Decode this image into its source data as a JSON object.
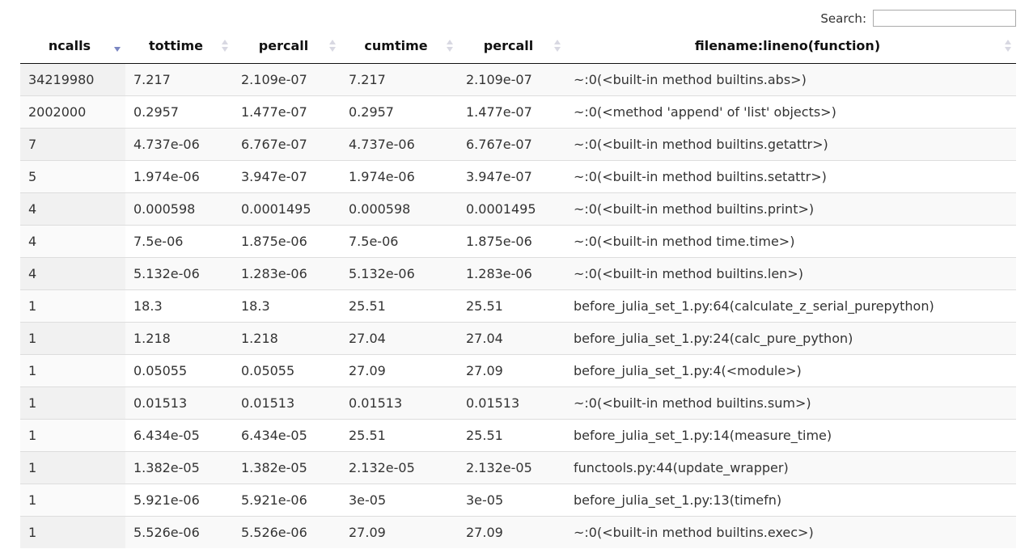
{
  "search": {
    "label": "Search:",
    "value": "",
    "placeholder": ""
  },
  "columns": [
    {
      "label": "ncalls",
      "sort": "descending"
    },
    {
      "label": "tottime",
      "sort": "none"
    },
    {
      "label": "percall",
      "sort": "none"
    },
    {
      "label": "cumtime",
      "sort": "none"
    },
    {
      "label": "percall",
      "sort": "none"
    },
    {
      "label": "filename:lineno(function)",
      "sort": "none"
    }
  ],
  "rows": [
    [
      "34219980",
      "7.217",
      "2.109e-07",
      "7.217",
      "2.109e-07",
      "~:0(<built-in method builtins.abs>)"
    ],
    [
      "2002000",
      "0.2957",
      "1.477e-07",
      "0.2957",
      "1.477e-07",
      "~:0(<method 'append' of 'list' objects>)"
    ],
    [
      "7",
      "4.737e-06",
      "6.767e-07",
      "4.737e-06",
      "6.767e-07",
      "~:0(<built-in method builtins.getattr>)"
    ],
    [
      "5",
      "1.974e-06",
      "3.947e-07",
      "1.974e-06",
      "3.947e-07",
      "~:0(<built-in method builtins.setattr>)"
    ],
    [
      "4",
      "0.000598",
      "0.0001495",
      "0.000598",
      "0.0001495",
      "~:0(<built-in method builtins.print>)"
    ],
    [
      "4",
      "7.5e-06",
      "1.875e-06",
      "7.5e-06",
      "1.875e-06",
      "~:0(<built-in method time.time>)"
    ],
    [
      "4",
      "5.132e-06",
      "1.283e-06",
      "5.132e-06",
      "1.283e-06",
      "~:0(<built-in method builtins.len>)"
    ],
    [
      "1",
      "18.3",
      "18.3",
      "25.51",
      "25.51",
      "before_julia_set_1.py:64(calculate_z_serial_purepython)"
    ],
    [
      "1",
      "1.218",
      "1.218",
      "27.04",
      "27.04",
      "before_julia_set_1.py:24(calc_pure_python)"
    ],
    [
      "1",
      "0.05055",
      "0.05055",
      "27.09",
      "27.09",
      "before_julia_set_1.py:4(<module>)"
    ],
    [
      "1",
      "0.01513",
      "0.01513",
      "0.01513",
      "0.01513",
      "~:0(<built-in method builtins.sum>)"
    ],
    [
      "1",
      "6.434e-05",
      "6.434e-05",
      "25.51",
      "25.51",
      "before_julia_set_1.py:14(measure_time)"
    ],
    [
      "1",
      "1.382e-05",
      "1.382e-05",
      "2.132e-05",
      "2.132e-05",
      "functools.py:44(update_wrapper)"
    ],
    [
      "1",
      "5.921e-06",
      "5.921e-06",
      "3e-05",
      "3e-05",
      "before_julia_set_1.py:13(timefn)"
    ],
    [
      "1",
      "5.526e-06",
      "5.526e-06",
      "27.09",
      "27.09",
      "~:0(<built-in method builtins.exec>)"
    ]
  ]
}
